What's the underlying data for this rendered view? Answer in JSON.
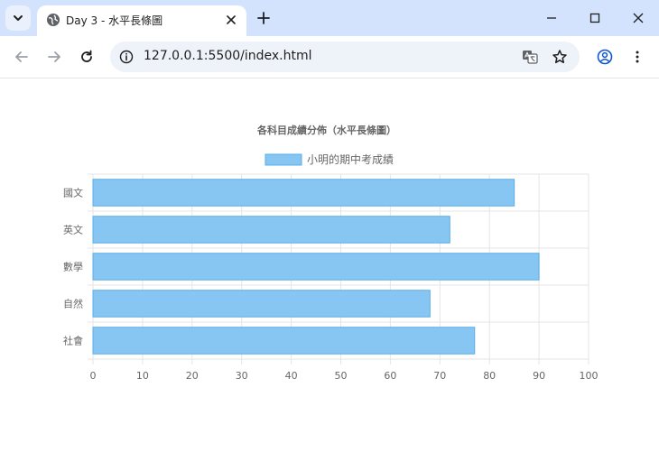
{
  "browser": {
    "tab_title": "Day 3 - 水平長條圖",
    "url": "127.0.0.1:5500/index.html"
  },
  "colors": {
    "bar_fill": "#87c6f3",
    "bar_border": "#5aaee8",
    "grid": "#e5e5e5",
    "text": "#666666"
  },
  "chart_data": {
    "type": "bar",
    "orientation": "horizontal",
    "title": "各科目成績分佈（水平長條圖）",
    "categories": [
      "國文",
      "英文",
      "數學",
      "自然",
      "社會"
    ],
    "series": [
      {
        "name": "小明的期中考成績",
        "values": [
          85,
          72,
          90,
          68,
          77
        ]
      }
    ],
    "xlim": [
      0,
      100
    ],
    "x_ticks": [
      0,
      10,
      20,
      30,
      40,
      50,
      60,
      70,
      80,
      90,
      100
    ],
    "grid": true,
    "legend_position": "top"
  }
}
